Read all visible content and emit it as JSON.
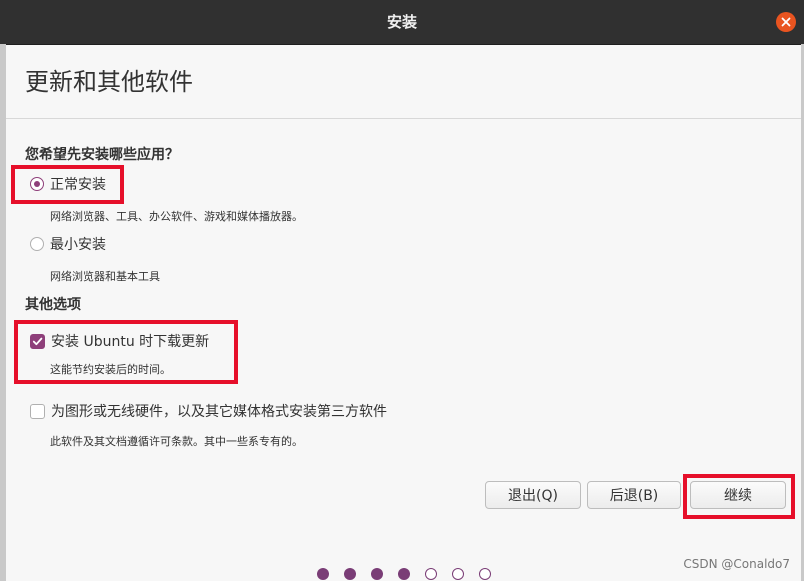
{
  "window": {
    "title": "安装"
  },
  "page": {
    "title": "更新和其他软件"
  },
  "apps_section": {
    "title": "您希望先安装哪些应用？",
    "normal": {
      "label": "正常安装",
      "description": "网络浏览器、工具、办公软件、游戏和媒体播放器。",
      "selected": true
    },
    "minimal": {
      "label": "最小安装",
      "description": "网络浏览器和基本工具",
      "selected": false
    }
  },
  "other_section": {
    "title": "其他选项",
    "download_updates": {
      "label": "安装 Ubuntu 时下载更新",
      "description": "这能节约安装后的时间。",
      "checked": true
    },
    "third_party": {
      "label": "为图形或无线硬件，以及其它媒体格式安装第三方软件",
      "description": "此软件及其文档遵循许可条款。其中一些系专有的。",
      "checked": false
    }
  },
  "buttons": {
    "quit": "退出(Q)",
    "back": "后退(B)",
    "continue": "继续"
  },
  "progress": {
    "total_steps": 7,
    "completed_steps": 4
  },
  "watermark": "CSDN @Conaldo7",
  "colors": {
    "accent": "#8e3f7a",
    "highlight": "#e60f2a",
    "close": "#e95420",
    "titlebar": "#303030"
  }
}
